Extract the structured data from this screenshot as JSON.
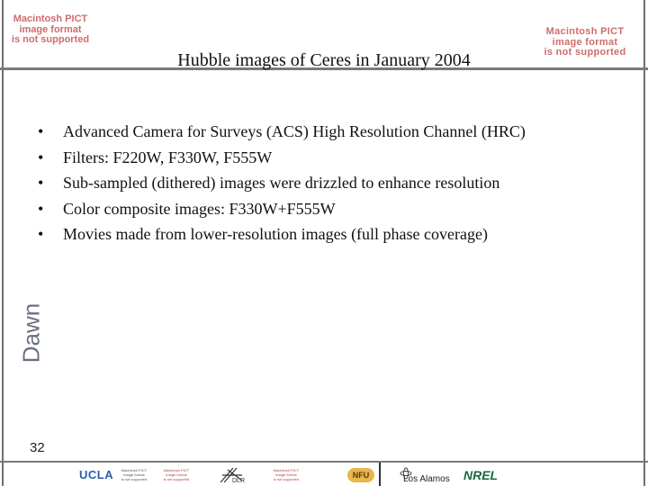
{
  "header": {
    "pict_left": [
      "Macintosh PICT",
      "image format",
      "is not supported"
    ],
    "pict_right": [
      "Macintosh PICT",
      "image format",
      "is not supported"
    ],
    "title": "Hubble images of Ceres in January 2004"
  },
  "sidebar": {
    "mission": "Dawn"
  },
  "bullets": [
    {
      "marker": "•",
      "text": "Advanced Camera for Surveys (ACS) High Resolution Channel (HRC)"
    },
    {
      "marker": "•",
      "text": "Filters: F220W, F330W, F555W"
    },
    {
      "marker": "•",
      "text": "Sub-sampled (dithered) images were drizzled to enhance resolution"
    },
    {
      "marker": "•",
      "text": "Color composite images: F330W+F555W"
    },
    {
      "marker": "•",
      "text": "Movies made from lower-resolution images (full phase coverage)"
    }
  ],
  "footer": {
    "page_number": "32",
    "logo_ucla": "UCLA",
    "tiny_pict": [
      "Macintosh PICT",
      "image format",
      "is not supported"
    ],
    "logo_dlr_text": "DLR",
    "logo_nfu": "NFU",
    "logo_los_alamos": "Los Alamos",
    "logo_nrel": "NREL"
  },
  "colors": {
    "pict_red": "#d06b6b",
    "rule_gray": "#7a7a7a",
    "dawn_gray": "#6a7080"
  }
}
